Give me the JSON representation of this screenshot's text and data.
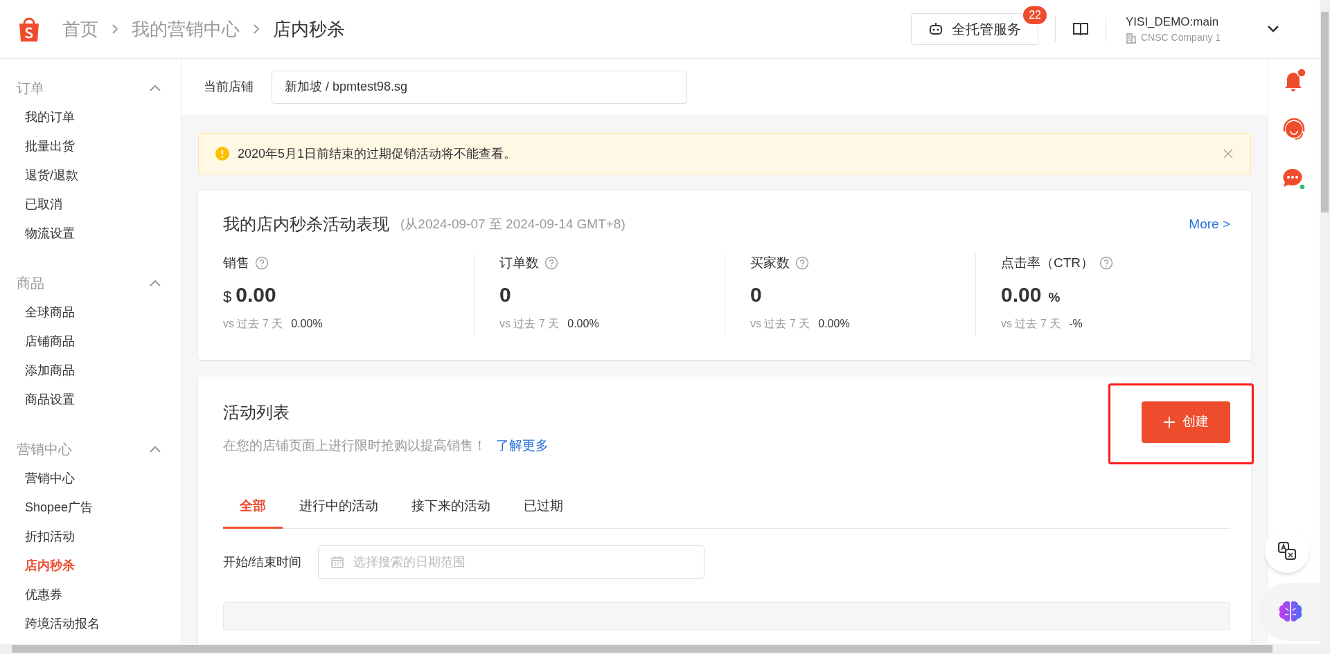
{
  "breadcrumb": [
    "首页",
    "我的营销中心",
    "店内秒杀"
  ],
  "header": {
    "service_button": "全托管服务",
    "service_badge": "22",
    "account": "YISI_DEMO:main",
    "company": "CNSC Company 1"
  },
  "sidebar": [
    {
      "title": "订单",
      "expanded": true,
      "items": [
        {
          "label": "我的订单",
          "selected": false
        },
        {
          "label": "批量出货",
          "selected": false
        },
        {
          "label": "退货/退款",
          "selected": false
        },
        {
          "label": "已取消",
          "selected": false
        },
        {
          "label": "物流设置",
          "selected": false
        }
      ]
    },
    {
      "title": "商品",
      "expanded": true,
      "items": [
        {
          "label": "全球商品",
          "selected": false
        },
        {
          "label": "店铺商品",
          "selected": false
        },
        {
          "label": "添加商品",
          "selected": false
        },
        {
          "label": "商品设置",
          "selected": false
        }
      ]
    },
    {
      "title": "营销中心",
      "expanded": true,
      "items": [
        {
          "label": "营销中心",
          "selected": false
        },
        {
          "label": "Shopee广告",
          "selected": false
        },
        {
          "label": "折扣活动",
          "selected": false
        },
        {
          "label": "店内秒杀",
          "selected": true
        },
        {
          "label": "优惠券",
          "selected": false
        },
        {
          "label": "跨境活动报名",
          "selected": false
        }
      ]
    }
  ],
  "store": {
    "label": "当前店铺",
    "value": "新加坡 / bpmtest98.sg"
  },
  "notice": "2020年5月1日前结束的过期促销活动将不能查看。",
  "performance": {
    "title": "我的店内秒杀活动表现",
    "period": "(从2024-09-07 至 2024-09-14 GMT+8)",
    "more": "More >",
    "metrics": [
      {
        "label": "销售",
        "prefix": "$",
        "value": "0.00",
        "compare": "vs 过去 7 天",
        "change": "0.00%"
      },
      {
        "label": "订单数",
        "value": "0",
        "compare": "vs 过去 7 天",
        "change": "0.00%"
      },
      {
        "label": "买家数",
        "value": "0",
        "compare": "vs 过去 7 天",
        "change": "0.00%"
      },
      {
        "label": "点击率（CTR）",
        "value": "0.00",
        "suffix": "%",
        "compare": "vs 过去 7 天",
        "change": "-%"
      }
    ]
  },
  "activities": {
    "title": "活动列表",
    "description": "在您的店铺页面上进行限时抢购以提高销售！",
    "learn_more": "了解更多",
    "create_button": "创建",
    "tabs": [
      {
        "label": "全部",
        "selected": true
      },
      {
        "label": "进行中的活动",
        "selected": false
      },
      {
        "label": "接下来的活动",
        "selected": false
      },
      {
        "label": "已过期",
        "selected": false
      }
    ],
    "date_filter": {
      "label": "开始/结束时间",
      "placeholder": "选择搜索的日期范围"
    }
  }
}
